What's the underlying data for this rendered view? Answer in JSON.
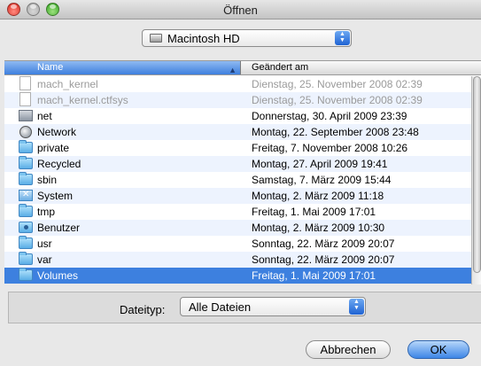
{
  "window": {
    "title": "Öffnen"
  },
  "location": {
    "label": "Macintosh HD"
  },
  "columns": {
    "name": "Name",
    "modified": "Geändert am"
  },
  "rows": [
    {
      "name": "mach_kernel",
      "date": "Dienstag, 25. November 2008 02:39",
      "icon": "document-icon",
      "dimmed": true
    },
    {
      "name": "mach_kernel.ctfsys",
      "date": "Dienstag, 25. November 2008 02:39",
      "icon": "document-icon",
      "dimmed": true
    },
    {
      "name": "net",
      "date": "Donnerstag, 30. April 2009 23:39",
      "icon": "network-folder-icon",
      "dimmed": false
    },
    {
      "name": "Network",
      "date": "Montag, 22. September 2008 23:48",
      "icon": "globe-icon",
      "dimmed": false
    },
    {
      "name": "private",
      "date": "Freitag, 7. November 2008 10:26",
      "icon": "folder-icon",
      "dimmed": false
    },
    {
      "name": "Recycled",
      "date": "Montag, 27. April 2009 19:41",
      "icon": "folder-icon",
      "dimmed": false
    },
    {
      "name": "sbin",
      "date": "Samstag, 7. März 2009 15:44",
      "icon": "folder-icon",
      "dimmed": false
    },
    {
      "name": "System",
      "date": "Montag, 2. März 2009 11:18",
      "icon": "system-folder-icon",
      "dimmed": false
    },
    {
      "name": "tmp",
      "date": "Freitag, 1. Mai 2009 17:01",
      "icon": "folder-icon",
      "dimmed": false
    },
    {
      "name": "Benutzer",
      "date": "Montag, 2. März 2009 10:30",
      "icon": "users-folder-icon",
      "dimmed": false
    },
    {
      "name": "usr",
      "date": "Sonntag, 22. März 2009 20:07",
      "icon": "folder-icon",
      "dimmed": false
    },
    {
      "name": "var",
      "date": "Sonntag, 22. März 2009 20:07",
      "icon": "folder-icon",
      "dimmed": false
    },
    {
      "name": "Volumes",
      "date": "Freitag, 1. Mai 2009 17:01",
      "icon": "folder-icon",
      "dimmed": false,
      "selected": true
    }
  ],
  "filetype": {
    "label": "Dateityp:",
    "value": "Alle Dateien"
  },
  "buttons": {
    "cancel": "Abbrechen",
    "ok": "OK"
  },
  "colors": {
    "selection": "#3d80df",
    "alt_row": "#edf3fe",
    "accent": "#3d86e6"
  }
}
